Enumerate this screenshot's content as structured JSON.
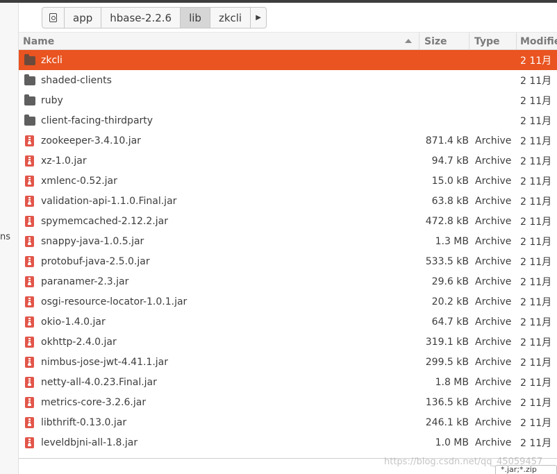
{
  "breadcrumb": {
    "items": [
      "app",
      "hbase-2.2.6",
      "lib",
      "zkcli"
    ],
    "active": "lib"
  },
  "sidebar": {
    "partial_text": "ns"
  },
  "columns": {
    "name": "Name",
    "size": "Size",
    "type": "Type",
    "modified": "Modifie"
  },
  "rows": [
    {
      "name": "zkcli",
      "kind": "folder",
      "size": "",
      "type": "",
      "modified": "2 11月",
      "selected": true
    },
    {
      "name": "shaded-clients",
      "kind": "folder",
      "size": "",
      "type": "",
      "modified": "2 11月"
    },
    {
      "name": "ruby",
      "kind": "folder",
      "size": "",
      "type": "",
      "modified": "2 11月"
    },
    {
      "name": "client-facing-thirdparty",
      "kind": "folder",
      "size": "",
      "type": "",
      "modified": "2 11月"
    },
    {
      "name": "zookeeper-3.4.10.jar",
      "kind": "archive",
      "size": "871.4 kB",
      "type": "Archive",
      "modified": "2 11月"
    },
    {
      "name": "xz-1.0.jar",
      "kind": "archive",
      "size": "94.7 kB",
      "type": "Archive",
      "modified": "2 11月"
    },
    {
      "name": "xmlenc-0.52.jar",
      "kind": "archive",
      "size": "15.0 kB",
      "type": "Archive",
      "modified": "2 11月"
    },
    {
      "name": "validation-api-1.1.0.Final.jar",
      "kind": "archive",
      "size": "63.8 kB",
      "type": "Archive",
      "modified": "2 11月"
    },
    {
      "name": "spymemcached-2.12.2.jar",
      "kind": "archive",
      "size": "472.8 kB",
      "type": "Archive",
      "modified": "2 11月"
    },
    {
      "name": "snappy-java-1.0.5.jar",
      "kind": "archive",
      "size": "1.3 MB",
      "type": "Archive",
      "modified": "2 11月"
    },
    {
      "name": "protobuf-java-2.5.0.jar",
      "kind": "archive",
      "size": "533.5 kB",
      "type": "Archive",
      "modified": "2 11月"
    },
    {
      "name": "paranamer-2.3.jar",
      "kind": "archive",
      "size": "29.6 kB",
      "type": "Archive",
      "modified": "2 11月"
    },
    {
      "name": "osgi-resource-locator-1.0.1.jar",
      "kind": "archive",
      "size": "20.2 kB",
      "type": "Archive",
      "modified": "2 11月"
    },
    {
      "name": "okio-1.4.0.jar",
      "kind": "archive",
      "size": "64.7 kB",
      "type": "Archive",
      "modified": "2 11月"
    },
    {
      "name": "okhttp-2.4.0.jar",
      "kind": "archive",
      "size": "319.1 kB",
      "type": "Archive",
      "modified": "2 11月"
    },
    {
      "name": "nimbus-jose-jwt-4.41.1.jar",
      "kind": "archive",
      "size": "299.5 kB",
      "type": "Archive",
      "modified": "2 11月"
    },
    {
      "name": "netty-all-4.0.23.Final.jar",
      "kind": "archive",
      "size": "1.8 MB",
      "type": "Archive",
      "modified": "2 11月"
    },
    {
      "name": "metrics-core-3.2.6.jar",
      "kind": "archive",
      "size": "136.5 kB",
      "type": "Archive",
      "modified": "2 11月"
    },
    {
      "name": "libthrift-0.13.0.jar",
      "kind": "archive",
      "size": "246.1 kB",
      "type": "Archive",
      "modified": "2 11月"
    },
    {
      "name": "leveldbjni-all-1.8.jar",
      "kind": "archive",
      "size": "1.0 MB",
      "type": "Archive",
      "modified": "2 11月"
    }
  ],
  "filter": {
    "value": "*.jar;*.zip"
  },
  "watermark": "https://blog.csdn.net/qq_45059457",
  "colors": {
    "selection": "#e95420",
    "archive_icon": "#e2564a",
    "folder_icon": "#5f5f5f"
  }
}
